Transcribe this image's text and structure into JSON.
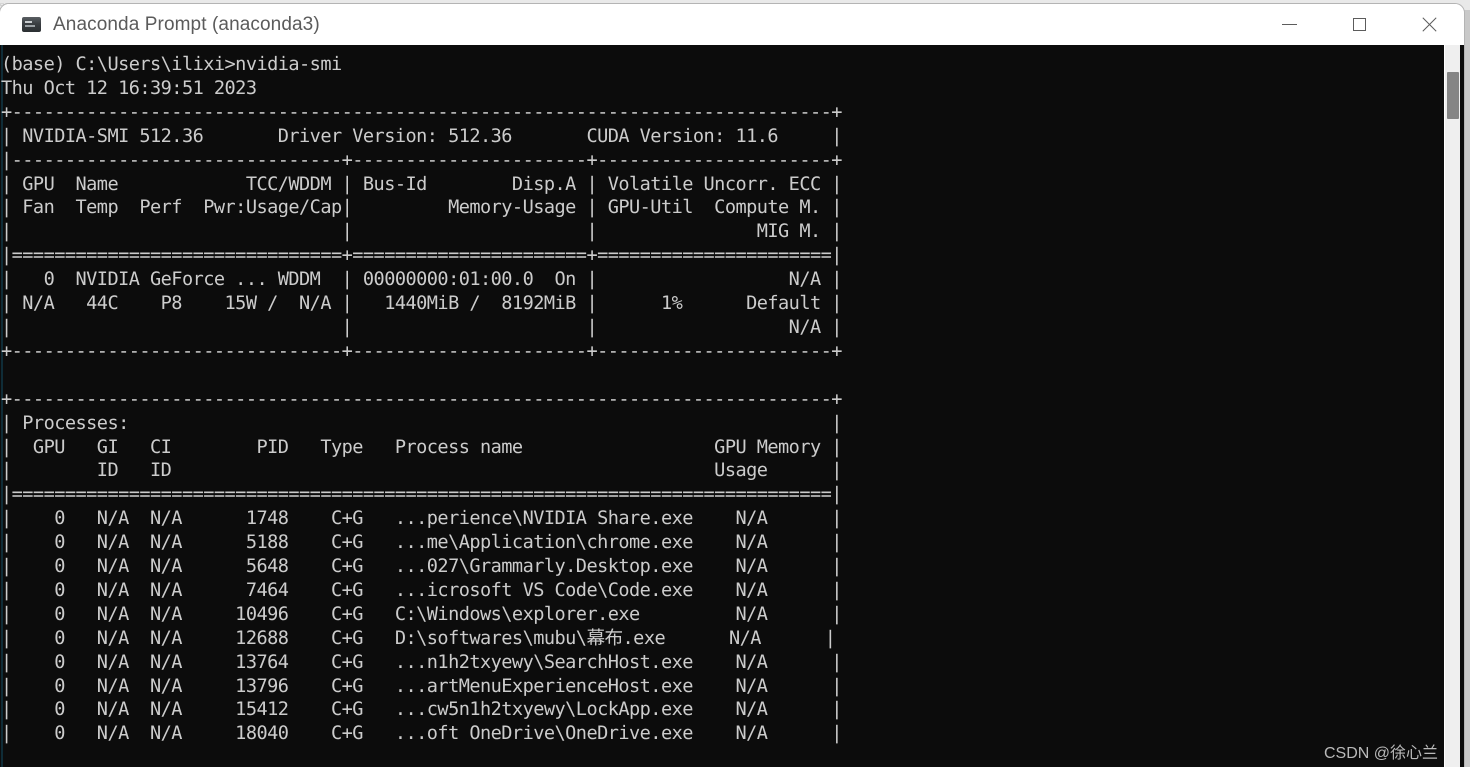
{
  "desktop": {
    "background_strip_text": "▫▪▫ ▫▪ ▫▫▪ ▪▫▪▫  ▪▫▪ ▫▪▫▪ ▫▪▫▫▪▫ ▫▪▫▫ ▪▫▪▫▫  ▫▪▫▪▫ ▫▪▫▫▪ ▫▪▫▫   ▫▪▫▫▪ ▫▪ ▪▫▫▪▫"
  },
  "window": {
    "title": "Anaconda Prompt (anaconda3)",
    "icon": "console-icon",
    "controls": {
      "minimize": "minimize-icon",
      "maximize": "maximize-icon",
      "close": "close-icon"
    }
  },
  "scrollbar": {
    "thumb_position_percent": 4
  },
  "watermark": {
    "text": "CSDN @徐心兰"
  },
  "terminal": {
    "prompt_line": "(base) C:\\Users\\ilixi>nvidia-smi",
    "timestamp": "Thu Oct 12 16:39:51 2023",
    "smi_version": "512.36",
    "driver_version": "512.36",
    "cuda_version": "11.6",
    "summary_header_line": "| NVIDIA-SMI 512.36       Driver Version: 512.36       CUDA Version: 11.6     |",
    "column_headers": {
      "row1": [
        "GPU",
        "Name",
        "TCC/WDDM",
        "Bus-Id",
        "Disp.A",
        "Volatile Uncorr. ECC"
      ],
      "row2": [
        "Fan",
        "Temp",
        "Perf",
        "Pwr:Usage/Cap",
        "Memory-Usage",
        "GPU-Util",
        "Compute M."
      ],
      "row3": [
        "MIG M."
      ]
    },
    "gpus": [
      {
        "index": "0",
        "name": "NVIDIA GeForce ...",
        "tcc_wddm": "WDDM",
        "bus_id": "00000000:01:00.0",
        "disp_a": "On",
        "uncorr_ecc": "N/A",
        "fan": "N/A",
        "temp": "44C",
        "perf": "P8",
        "pwr_usage": "15W",
        "pwr_cap": "N/A",
        "memory_used": "1440MiB",
        "memory_total": "8192MiB",
        "gpu_util": "1%",
        "compute_mode": "Default",
        "mig_mode": "N/A"
      }
    ],
    "processes_title": "Processes:",
    "processes_headers": {
      "row1": [
        "GPU",
        "GI",
        "CI",
        "PID",
        "Type",
        "Process name",
        "GPU Memory"
      ],
      "row2": [
        "ID",
        "ID",
        "Usage"
      ]
    },
    "processes": [
      {
        "gpu": "0",
        "gi_id": "N/A",
        "ci_id": "N/A",
        "pid": "1748",
        "type": "C+G",
        "name": "...perience\\NVIDIA Share.exe",
        "memory": "N/A"
      },
      {
        "gpu": "0",
        "gi_id": "N/A",
        "ci_id": "N/A",
        "pid": "5188",
        "type": "C+G",
        "name": "...me\\Application\\chrome.exe",
        "memory": "N/A"
      },
      {
        "gpu": "0",
        "gi_id": "N/A",
        "ci_id": "N/A",
        "pid": "5648",
        "type": "C+G",
        "name": "...027\\Grammarly.Desktop.exe",
        "memory": "N/A"
      },
      {
        "gpu": "0",
        "gi_id": "N/A",
        "ci_id": "N/A",
        "pid": "7464",
        "type": "C+G",
        "name": "...icrosoft VS Code\\Code.exe",
        "memory": "N/A"
      },
      {
        "gpu": "0",
        "gi_id": "N/A",
        "ci_id": "N/A",
        "pid": "10496",
        "type": "C+G",
        "name": "C:\\Windows\\explorer.exe",
        "memory": "N/A"
      },
      {
        "gpu": "0",
        "gi_id": "N/A",
        "ci_id": "N/A",
        "pid": "12688",
        "type": "C+G",
        "name": "D:\\softwares\\mubu\\幕布.exe",
        "memory": "N/A"
      },
      {
        "gpu": "0",
        "gi_id": "N/A",
        "ci_id": "N/A",
        "pid": "13764",
        "type": "C+G",
        "name": "...n1h2txyewy\\SearchHost.exe",
        "memory": "N/A"
      },
      {
        "gpu": "0",
        "gi_id": "N/A",
        "ci_id": "N/A",
        "pid": "13796",
        "type": "C+G",
        "name": "...artMenuExperienceHost.exe",
        "memory": "N/A"
      },
      {
        "gpu": "0",
        "gi_id": "N/A",
        "ci_id": "N/A",
        "pid": "15412",
        "type": "C+G",
        "name": "...cw5n1h2txyewy\\LockApp.exe",
        "memory": "N/A"
      },
      {
        "gpu": "0",
        "gi_id": "N/A",
        "ci_id": "N/A",
        "pid": "18040",
        "type": "C+G",
        "name": "...oft OneDrive\\OneDrive.exe",
        "memory": "N/A"
      }
    ],
    "full_output": "(base) C:\\Users\\ilixi>nvidia-smi\nThu Oct 12 16:39:51 2023\n+-----------------------------------------------------------------------------+\n| NVIDIA-SMI 512.36       Driver Version: 512.36       CUDA Version: 11.6     |\n|-------------------------------+----------------------+----------------------+\n| GPU  Name            TCC/WDDM | Bus-Id        Disp.A | Volatile Uncorr. ECC |\n| Fan  Temp  Perf  Pwr:Usage/Cap|         Memory-Usage | GPU-Util  Compute M. |\n|                               |                      |               MIG M. |\n|===============================+======================+======================|\n|   0  NVIDIA GeForce ... WDDM  | 00000000:01:00.0  On |                  N/A |\n| N/A   44C    P8    15W /  N/A |   1440MiB /  8192MiB |      1%      Default |\n|                               |                      |                  N/A |\n+-------------------------------+----------------------+----------------------+\n\n+-----------------------------------------------------------------------------+\n| Processes:                                                                  |\n|  GPU   GI   CI        PID   Type   Process name                  GPU Memory |\n|        ID   ID                                                   Usage      |\n|=============================================================================|\n|    0   N/A  N/A      1748    C+G   ...perience\\NVIDIA Share.exe    N/A      |\n|    0   N/A  N/A      5188    C+G   ...me\\Application\\chrome.exe    N/A      |\n|    0   N/A  N/A      5648    C+G   ...027\\Grammarly.Desktop.exe    N/A      |\n|    0   N/A  N/A      7464    C+G   ...icrosoft VS Code\\Code.exe    N/A      |\n|    0   N/A  N/A     10496    C+G   C:\\Windows\\explorer.exe         N/A      |\n|    0   N/A  N/A     12688    C+G   D:\\softwares\\mubu\\幕布.exe      N/A      |\n|    0   N/A  N/A     13764    C+G   ...n1h2txyewy\\SearchHost.exe    N/A      |\n|    0   N/A  N/A     13796    C+G   ...artMenuExperienceHost.exe    N/A      |\n|    0   N/A  N/A     15412    C+G   ...cw5n1h2txyewy\\LockApp.exe    N/A      |\n|    0   N/A  N/A     18040    C+G   ...oft OneDrive\\OneDrive.exe    N/A      |"
  }
}
